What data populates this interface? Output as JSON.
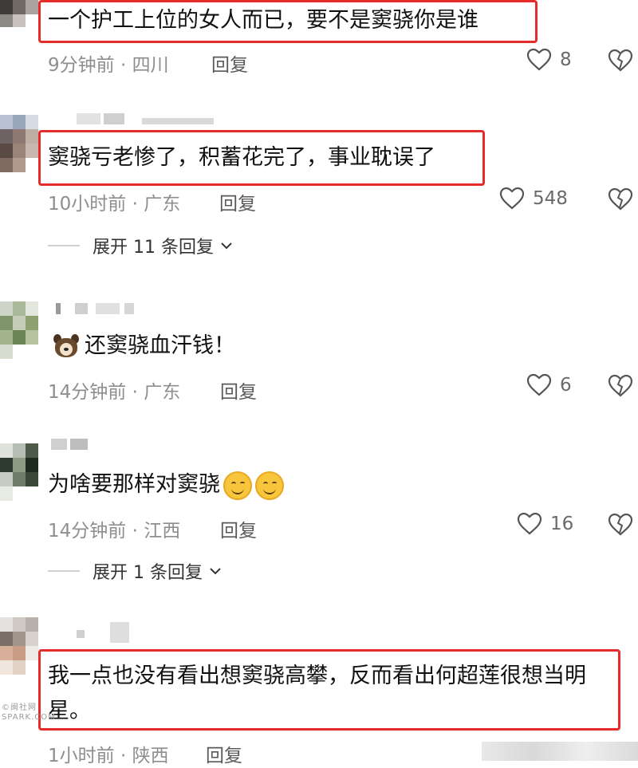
{
  "colors": {
    "highlight": "#e62b2b",
    "meta": "#8e8e8e",
    "text": "#111111"
  },
  "comments": [
    {
      "text": "一个护工上位的女人而已，要不是窦骁你是谁",
      "time": "9分钟前",
      "sep": "·",
      "location": "四川",
      "reply": "回复",
      "likes": "8"
    },
    {
      "text": "窦骁亏老惨了，积蓄花完了，事业耽误了",
      "time": "10小时前",
      "sep": "·",
      "location": "广东",
      "reply": "回复",
      "likes": "548",
      "expand": "展开 11 条回复"
    },
    {
      "text": "还窦骁血汗钱！",
      "emoji": "dog-face-emoji",
      "time": "14分钟前",
      "sep": "·",
      "location": "广东",
      "reply": "回复",
      "likes": "6"
    },
    {
      "text": "为啥要那样对窦骁",
      "emoji": "smiling-face-emoji",
      "time": "14分钟前",
      "sep": "·",
      "location": "江西",
      "reply": "回复",
      "likes": "16",
      "expand": "展开 1 条回复"
    },
    {
      "text": "我一点也没有看出想窦骁高攀，反而看出何超莲很想当明星。",
      "time": "1小时前",
      "sep": "·",
      "location": "陕西",
      "reply": "回复"
    }
  ],
  "watermark": {
    "line1": "©闽社网",
    "line2": "SPARK.COM"
  }
}
